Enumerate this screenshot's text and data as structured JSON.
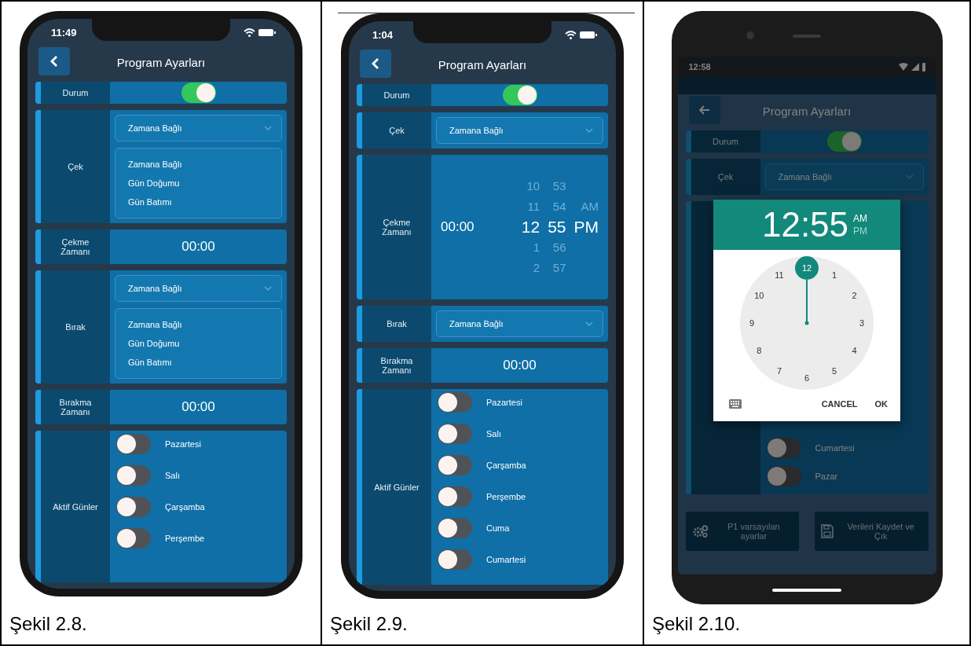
{
  "figures": [
    {
      "caption": "Şekil 2.8.",
      "device": {
        "kind": "ios",
        "time": "11:49",
        "title": "Program Ayarları",
        "rows": [
          {
            "kind": "toggle",
            "label": "Durum",
            "on": true
          },
          {
            "kind": "dropdown",
            "label": "Çek",
            "value": "Zamana Bağlı",
            "options": [
              "Zamana Bağlı",
              "Gün Doğumu",
              "Gün Batımı"
            ]
          },
          {
            "kind": "time",
            "label": "Çekme Zamanı",
            "value": "00:00"
          },
          {
            "kind": "dropdown",
            "label": "Bırak",
            "value": "Zamana Bağlı",
            "options": [
              "Zamana Bağlı",
              "Gün Doğumu",
              "Gün Batımı"
            ]
          },
          {
            "kind": "time",
            "label": "Bırakma Zamanı",
            "value": "00:00"
          },
          {
            "kind": "days",
            "label": "Aktif Günler",
            "days": [
              {
                "name": "Pazartesi",
                "on": false
              },
              {
                "name": "Salı",
                "on": false
              },
              {
                "name": "Çarşamba",
                "on": false
              },
              {
                "name": "Perşembe",
                "on": false
              }
            ]
          }
        ]
      }
    },
    {
      "caption": "Şekil 2.9.",
      "device": {
        "kind": "ios",
        "time": "1:04",
        "title": "Program Ayarları",
        "rows": [
          {
            "kind": "toggle",
            "label": "Durum",
            "on": true
          },
          {
            "kind": "dropdown",
            "label": "Çek",
            "value": "Zamana Bağlı"
          },
          {
            "kind": "picker",
            "label": "Çekme Zamanı",
            "value": "00:00",
            "columns": [
              {
                "items": [
                  {
                    "text": "10",
                    "selected": false
                  },
                  {
                    "text": "11",
                    "selected": false
                  },
                  {
                    "text": "12",
                    "selected": true
                  },
                  {
                    "text": "1",
                    "selected": false
                  },
                  {
                    "text": "2",
                    "selected": false
                  }
                ]
              },
              {
                "items": [
                  {
                    "text": "53",
                    "selected": false
                  },
                  {
                    "text": "54",
                    "selected": false
                  },
                  {
                    "text": "55",
                    "selected": true
                  },
                  {
                    "text": "56",
                    "selected": false
                  },
                  {
                    "text": "57",
                    "selected": false
                  }
                ]
              },
              {
                "items": [
                  {
                    "text": "AM",
                    "selected": false
                  },
                  {
                    "text": "PM",
                    "selected": true
                  }
                ]
              }
            ]
          },
          {
            "kind": "dropdown",
            "label": "Bırak",
            "value": "Zamana Bağlı"
          },
          {
            "kind": "time",
            "label": "Bırakma Zamanı",
            "value": "00:00"
          },
          {
            "kind": "days",
            "label": "Aktif Günler",
            "days": [
              {
                "name": "Pazartesi",
                "on": false
              },
              {
                "name": "Salı",
                "on": false
              },
              {
                "name": "Çarşamba",
                "on": false
              },
              {
                "name": "Perşembe",
                "on": false
              },
              {
                "name": "Cuma",
                "on": false
              },
              {
                "name": "Cumartesi",
                "on": false
              }
            ]
          }
        ]
      }
    },
    {
      "caption": "Şekil 2.10.",
      "device": {
        "kind": "android",
        "time": "12:58",
        "title": "Program Ayarları",
        "rows": [
          {
            "kind": "toggle",
            "label": "Durum",
            "on": true
          },
          {
            "kind": "dropdown",
            "label": "Çek",
            "value": "Zamana Bağlı"
          },
          {
            "kind": "days",
            "days": [
              {
                "name": "Cumartesi",
                "on": false
              },
              {
                "name": "Pazar",
                "on": false
              }
            ]
          }
        ],
        "buttons": [
          {
            "label": "P1 varsayılan ayarlar",
            "kind": "settings"
          },
          {
            "label": "Verileri Kaydet ve Çık",
            "kind": "save"
          }
        ],
        "dialog": {
          "time": "12:55",
          "periods": [
            {
              "text": "AM",
              "selected": true
            },
            {
              "text": "PM",
              "selected": false
            }
          ],
          "dial": [
            {
              "text": "12",
              "selected": true
            },
            {
              "text": "1",
              "selected": false
            },
            {
              "text": "2",
              "selected": false
            },
            {
              "text": "3",
              "selected": false
            },
            {
              "text": "4",
              "selected": false
            },
            {
              "text": "5",
              "selected": false
            },
            {
              "text": "6",
              "selected": false
            },
            {
              "text": "7",
              "selected": false
            },
            {
              "text": "8",
              "selected": false
            },
            {
              "text": "9",
              "selected": false
            },
            {
              "text": "10",
              "selected": false
            },
            {
              "text": "11",
              "selected": false
            }
          ],
          "actions": [
            "CANCEL",
            "OK"
          ]
        }
      }
    }
  ]
}
